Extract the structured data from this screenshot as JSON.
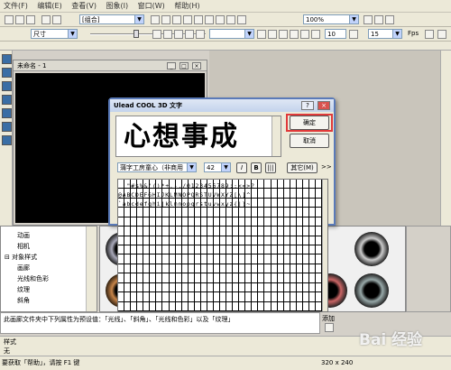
{
  "menu": [
    "文件(F)",
    "编辑(E)",
    "查看(V)",
    "图象(I)",
    "窗口(W)",
    "帮助(H)"
  ],
  "toolbar1": {
    "group_combo": "[组合]",
    "zoom_combo": "100%"
  },
  "toolbar2": {
    "size_combo": "尺寸",
    "spin1": "10",
    "spin2": "15",
    "fps_label": "Fps"
  },
  "document": {
    "title": "未命名 - 1"
  },
  "tree": {
    "items": [
      "动画",
      "相机",
      "对象样式",
      "画廊",
      "光线和色彩",
      "纹理",
      "斜角"
    ]
  },
  "description": "此画廊文件夹中下列属性为预设值：「光线」、「斜角」、「光线和色彩」以及「纹理」",
  "add_label": "添加",
  "style": {
    "label": "样式",
    "value": "无"
  },
  "status": {
    "left": "要获取「帮助」，请按 F1 键",
    "right": "320 x 240"
  },
  "watermark": "Bai 经验",
  "dialog": {
    "title": "Ulead COOL 3D 文字",
    "preview_text": "心想事成",
    "ok": "确定",
    "cancel": "取消",
    "font": "蒲字工房童心（非商用",
    "size": "42",
    "italic": "I",
    "bold": "B",
    "other": "其它(M)",
    "more": ">>",
    "char_rows": [
      " !\"#$%&'()*+,-./0123456789:;<=>?",
      "@ABCDEFGHIJKLMNOPQRSTUVWXYZ[\\]^_",
      "`abcdefghijklmnopqrstuvwxyz{|}~"
    ]
  },
  "colors": {
    "highlight": "#e0393a",
    "dialog_border": "#5a7ab8",
    "canvas": "#000000"
  }
}
